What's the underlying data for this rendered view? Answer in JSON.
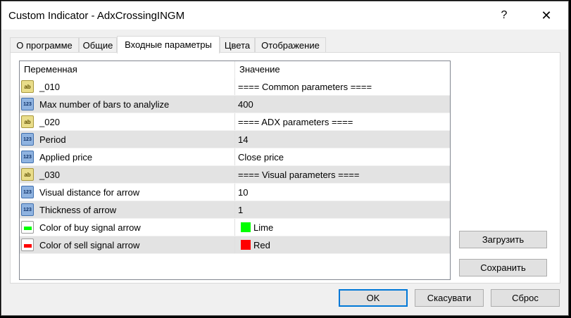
{
  "window": {
    "title": "Custom Indicator - AdxCrossingINGM",
    "help_label": "?",
    "close_label": "✕"
  },
  "tabs": [
    {
      "label": "О программе"
    },
    {
      "label": "Общие"
    },
    {
      "label": "Входные параметры",
      "active": true
    },
    {
      "label": "Цвета"
    },
    {
      "label": "Отображение"
    }
  ],
  "grid": {
    "col_variable": "Переменная",
    "col_value": "Значение",
    "rows": [
      {
        "icon": "ab",
        "name": "_010",
        "value": "==== Common parameters ===="
      },
      {
        "icon": "123",
        "name": "Max number of bars to analylize",
        "value": "400"
      },
      {
        "icon": "ab",
        "name": "_020",
        "value": "==== ADX parameters ===="
      },
      {
        "icon": "123",
        "name": "Period",
        "value": "14"
      },
      {
        "icon": "123",
        "name": "Applied price",
        "value": "Close price"
      },
      {
        "icon": "ab",
        "name": "_030",
        "value": "==== Visual parameters ===="
      },
      {
        "icon": "123",
        "name": "Visual distance for arrow",
        "value": "10"
      },
      {
        "icon": "123",
        "name": "Thickness of arrow",
        "value": "1"
      },
      {
        "icon": "color",
        "name": "Color of buy signal arrow",
        "value": "Lime",
        "color": "#00ff00"
      },
      {
        "icon": "color",
        "name": "Color of sell signal arrow",
        "value": "Red",
        "color": "#ff0000"
      }
    ]
  },
  "side_buttons": {
    "load": "Загрузить",
    "save": "Сохранить"
  },
  "footer": {
    "ok": "OK",
    "cancel": "Скасувати",
    "reset": "Сброс"
  },
  "icons": {
    "ab_text": "ab",
    "num_text": "123"
  }
}
